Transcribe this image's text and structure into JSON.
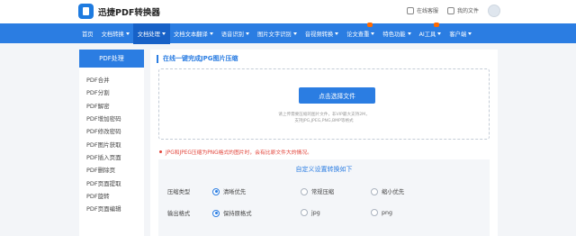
{
  "header": {
    "brand": "迅捷PDF转换器",
    "links": [
      "在线客服",
      "我的文件"
    ]
  },
  "nav": [
    {
      "label": "首页",
      "caret": false
    },
    {
      "label": "文档转换",
      "caret": true
    },
    {
      "label": "文档处理",
      "caret": true,
      "active": true
    },
    {
      "label": "文档文本翻译",
      "caret": true
    },
    {
      "label": "语音识别",
      "caret": true
    },
    {
      "label": "图片文字识别",
      "caret": true
    },
    {
      "label": "音视频转换",
      "caret": true
    },
    {
      "label": "论文查重",
      "caret": true,
      "badge": "hot"
    },
    {
      "label": "特色功能",
      "caret": true
    },
    {
      "label": "AI工具",
      "caret": true,
      "badge": "hot"
    },
    {
      "label": "客户端",
      "caret": true
    }
  ],
  "sidebar": {
    "title": "PDF处理",
    "items": [
      "PDF合并",
      "PDF分割",
      "PDF解密",
      "PDF增加密码",
      "PDF修改密码",
      "PDF图片获取",
      "PDF插入页面",
      "PDF删除页",
      "PDF页面提取",
      "PDF旋转",
      "PDF页面编辑"
    ]
  },
  "main": {
    "title": "在线一键完成JPG图片压缩",
    "upload_button": "点击选择文件",
    "hint_line1": "请上传需要压缩的图片文件，非VIP最大支持2M，",
    "hint_line2": "支持JPG,JPEG,PNG,BMP等格式",
    "notice": "JPG和JPEG压缩为PNG格式的图片时，会有比原文件大的情况。",
    "settings": {
      "title": "自定义设置转换如下",
      "rows": [
        {
          "label": "压缩类型",
          "options": [
            "清晰优先",
            "常规压缩",
            "缩小优先"
          ],
          "selected": 0
        },
        {
          "label": "输出格式",
          "options": [
            "保持原格式",
            "jpg",
            "png"
          ],
          "selected": 0
        }
      ]
    }
  },
  "colors": {
    "accent": "#2b7de2",
    "notice": "#e2443a"
  }
}
